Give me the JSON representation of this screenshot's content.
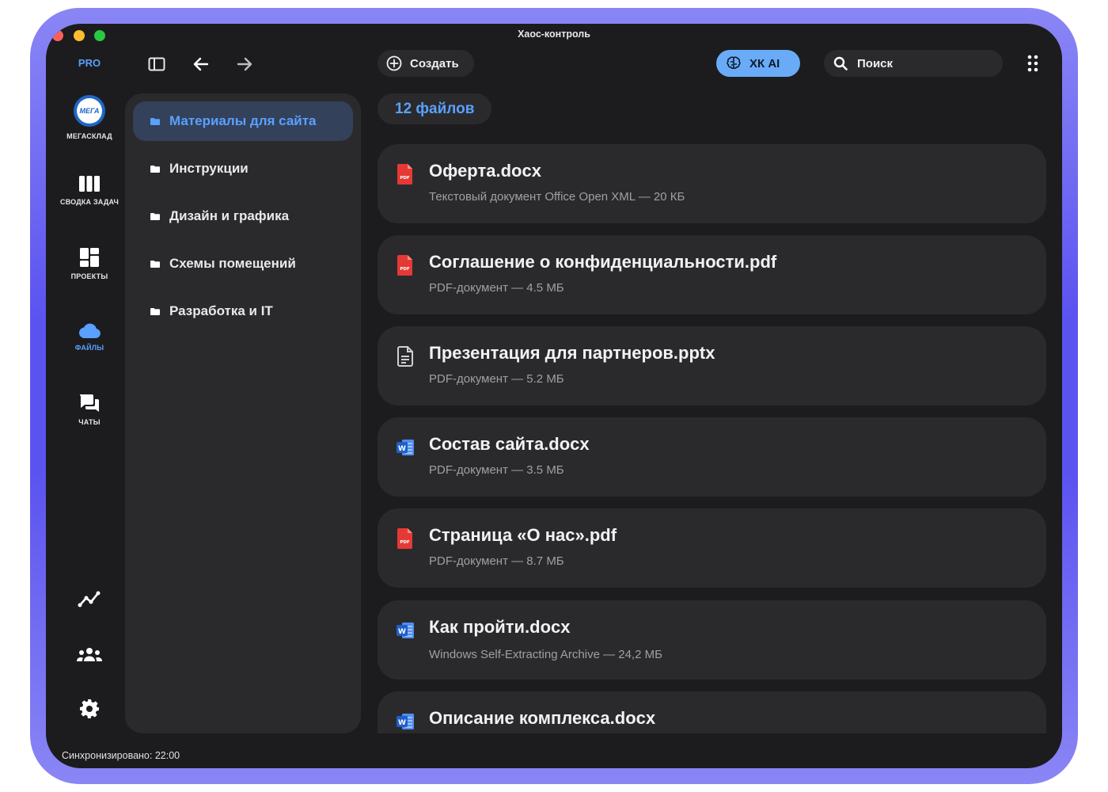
{
  "window": {
    "title": "Хаос-контроль",
    "plan_badge": "PRO"
  },
  "colors": {
    "accent": "#5aa0ff",
    "window_bg": "#1c1c1e",
    "panel_bg": "#2a2a2d",
    "active_bg": "#33415a",
    "frame": "#6b64f2",
    "pdf_red": "#e53935",
    "word_blue": "#2b6fd6"
  },
  "toolbar": {
    "sidebar_toggle_icon": "sidebar-toggle-icon",
    "back_icon": "arrow-left-icon",
    "forward_icon": "arrow-right-icon",
    "create_label": "Создать",
    "ai_label": "ХК AI",
    "search_placeholder": "Поиск",
    "apps_icon": "grid-dots-icon"
  },
  "nav": {
    "workspace": {
      "label": "МЕГАСКЛАД",
      "logo_text": "МЕГА"
    },
    "items": [
      {
        "label": "СВОДКА ЗАДАЧ",
        "icon": "kanban-icon"
      },
      {
        "label": "ПРОЕКТЫ",
        "icon": "dashboard-icon"
      },
      {
        "label": "ФАЙЛЫ",
        "icon": "cloud-icon",
        "active": true
      },
      {
        "label": "ЧАТЫ",
        "icon": "chat-icon"
      }
    ],
    "bottom": [
      {
        "icon": "analytics-icon"
      },
      {
        "icon": "team-icon"
      },
      {
        "icon": "settings-icon"
      }
    ]
  },
  "folders": [
    {
      "label": "Материалы для сайта",
      "active": true
    },
    {
      "label": "Инструкции"
    },
    {
      "label": "Дизайн и графика"
    },
    {
      "label": "Схемы помещений"
    },
    {
      "label": "Разработка и IT"
    }
  ],
  "files_count": "12 файлов",
  "files": [
    {
      "name": "Оферта.docx",
      "meta": "Текстовый документ Office Open XML — 20 КБ",
      "icon": "pdf-icon"
    },
    {
      "name": "Соглашение о конфиденциальности.pdf",
      "meta": "PDF-документ — 4.5 МБ",
      "icon": "pdf-icon"
    },
    {
      "name": "Презентация для партнеров.pptx",
      "meta": "PDF-документ — 5.2 МБ",
      "icon": "document-icon"
    },
    {
      "name": "Состав сайта.docx",
      "meta": "PDF-документ — 3.5 МБ",
      "icon": "word-icon"
    },
    {
      "name": "Страница «О нас».pdf",
      "meta": "PDF-документ — 8.7 МБ",
      "icon": "pdf-icon"
    },
    {
      "name": "Как пройти.docx",
      "meta": "Windows Self-Extracting Archive — 24,2 МБ",
      "icon": "word-icon"
    },
    {
      "name": "Описание комплекса.docx",
      "meta": "",
      "icon": "word-icon"
    }
  ],
  "status": {
    "sync_text": "Синхронизировано: 22:00"
  }
}
